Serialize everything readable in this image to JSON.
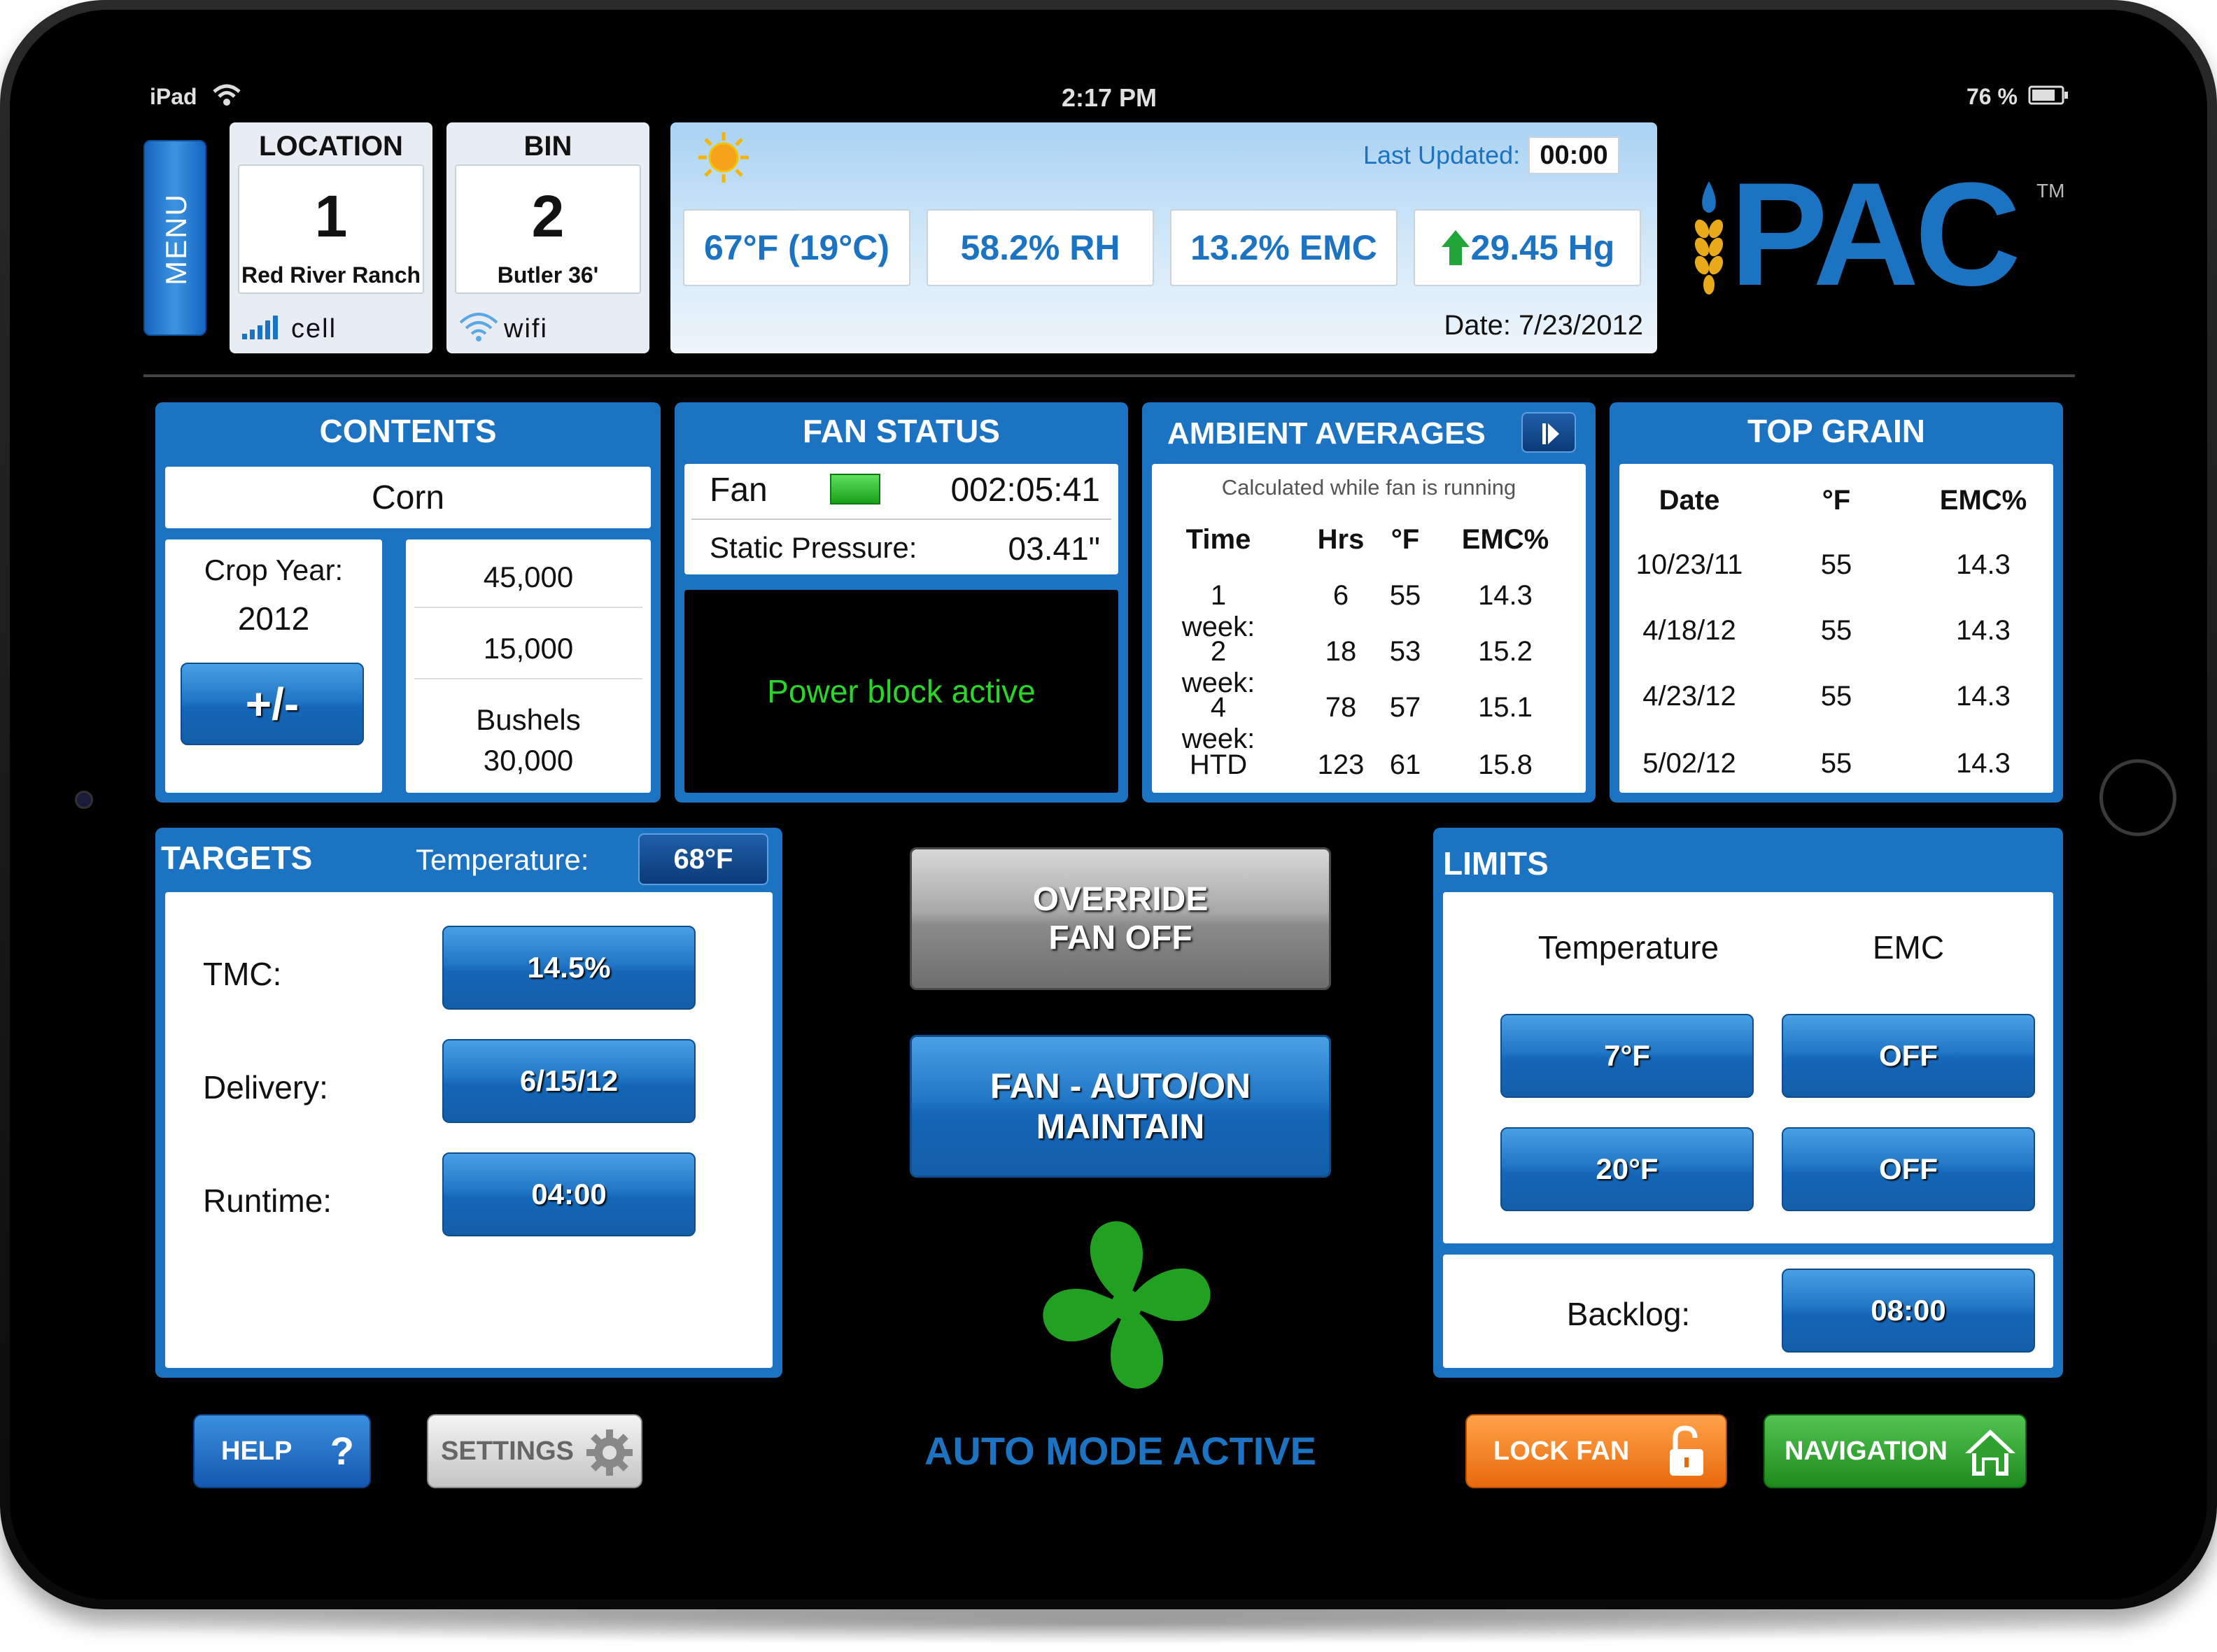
{
  "status_bar": {
    "device": "iPad",
    "time": "2:17 PM",
    "battery": "76 %"
  },
  "menu": {
    "label": "MENU"
  },
  "location": {
    "title": "LOCATION",
    "number": "1",
    "name": "Red River Ranch",
    "signal": "cell"
  },
  "bin": {
    "title": "BIN",
    "number": "2",
    "name": "Butler 36'",
    "signal": "wifi"
  },
  "weather": {
    "last_updated_label": "Last Updated:",
    "last_updated_value": "00:00",
    "temperature": "67°F (19°C)",
    "humidity": "58.2% RH",
    "emc": "13.2% EMC",
    "pressure": "29.45 Hg",
    "date": "Date: 7/23/2012",
    "icon": "sun-icon"
  },
  "logo": {
    "text": "PAC",
    "tm": "TM"
  },
  "contents": {
    "title": "CONTENTS",
    "crop": "Corn",
    "crop_year_label": "Crop Year:",
    "crop_year": "2012",
    "adjust_label": "+/-",
    "capacity": "45,000",
    "remaining": "15,000",
    "bushels_label": "Bushels",
    "bushels": "30,000"
  },
  "fan_status": {
    "title": "FAN STATUS",
    "fan_label": "Fan",
    "fan_time": "002:05:41",
    "static_label": "Static Pressure:",
    "static_value": "03.41\"",
    "message": "Power block active",
    "indicator_color": "#2db52d"
  },
  "ambient": {
    "title": "AMBIENT AVERAGES",
    "subtitle": "Calculated while fan is running",
    "headers": [
      "Time",
      "Hrs",
      "°F",
      "EMC%"
    ],
    "rows": [
      [
        "1 week:",
        "6",
        "55",
        "14.3"
      ],
      [
        "2 week:",
        "18",
        "53",
        "15.2"
      ],
      [
        "4 week:",
        "78",
        "57",
        "15.1"
      ],
      [
        "HTD",
        "123",
        "61",
        "15.8"
      ]
    ]
  },
  "top_grain": {
    "title": "TOP GRAIN",
    "headers": [
      "Date",
      "°F",
      "EMC%"
    ],
    "rows": [
      [
        "10/23/11",
        "55",
        "14.3"
      ],
      [
        "4/18/12",
        "55",
        "14.3"
      ],
      [
        "4/23/12",
        "55",
        "14.3"
      ],
      [
        "5/02/12",
        "55",
        "14.3"
      ]
    ]
  },
  "targets": {
    "title": "TARGETS",
    "temperature_label": "Temperature:",
    "temperature_value": "68°F",
    "tmc_label": "TMC:",
    "tmc_value": "14.5%",
    "delivery_label": "Delivery:",
    "delivery_value": "6/15/12",
    "runtime_label": "Runtime:",
    "runtime_value": "04:00"
  },
  "controls": {
    "override_line1": "OVERRIDE",
    "override_line2": "FAN OFF",
    "auto_line1": "FAN - AUTO/ON",
    "auto_line2": "MAINTAIN",
    "mode": "AUTO MODE ACTIVE",
    "fan_color": "#22a022"
  },
  "limits": {
    "title": "LIMITS",
    "temperature_header": "Temperature",
    "emc_header": "EMC",
    "temp_low": "7°F",
    "emc_low": "OFF",
    "temp_high": "20°F",
    "emc_high": "OFF",
    "backlog_label": "Backlog:",
    "backlog_value": "08:00"
  },
  "bottom": {
    "help": "HELP",
    "help_glyph": "?",
    "settings": "SETTINGS",
    "lock": "LOCK FAN",
    "navigation": "NAVIGATION"
  },
  "colors": {
    "accent": "#1b73c2",
    "lock": "#f07a1a",
    "nav": "#2ea02e",
    "status_text": "#29d629"
  }
}
